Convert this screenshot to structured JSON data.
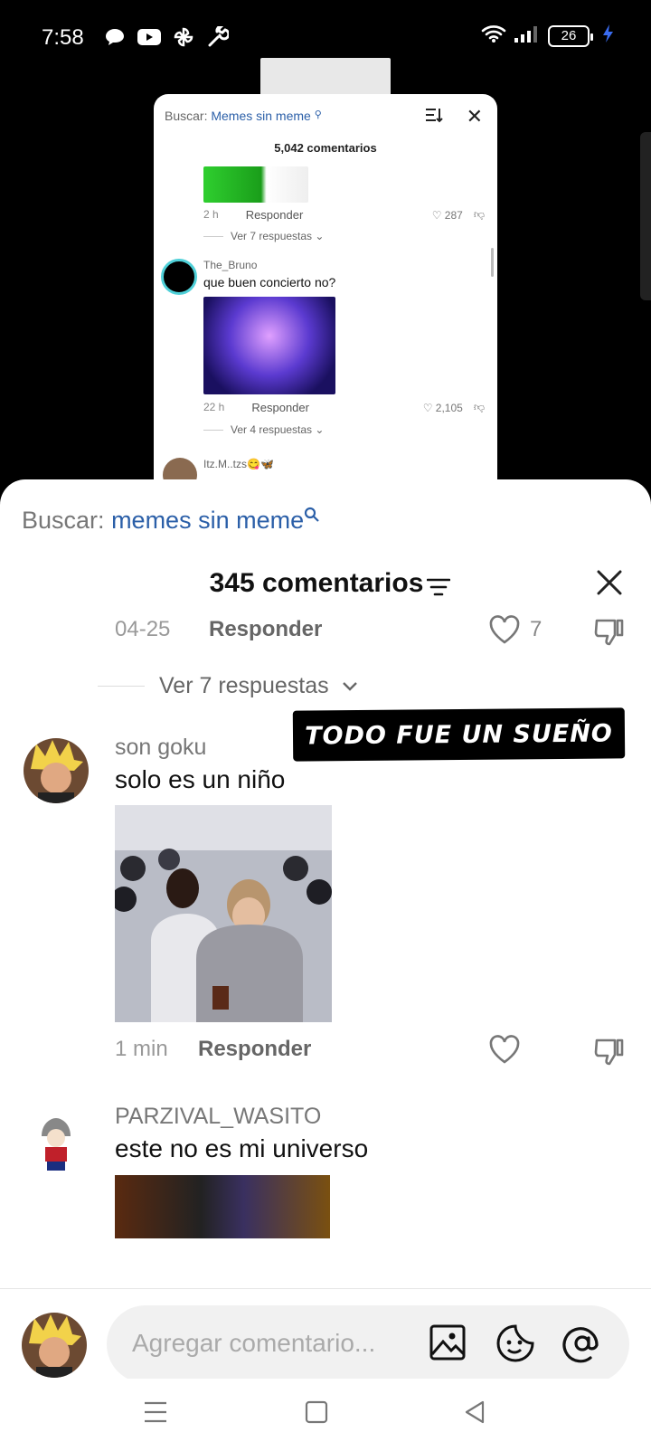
{
  "status_bar": {
    "time": "7:58",
    "battery": "26",
    "icons_left": [
      "chat-bubble-icon",
      "youtube-icon",
      "pinwheel-icon",
      "wrench-icon"
    ],
    "icons_right": [
      "wifi-icon",
      "signal-icon",
      "battery-icon",
      "charging-icon"
    ]
  },
  "mini_panel": {
    "search_label": "Buscar:",
    "search_query": "Memes sin meme",
    "count": "5,042 comentarios",
    "comment1": {
      "time": "2 h",
      "reply": "Responder",
      "likes": "287",
      "replies": "Ver 7 respuestas"
    },
    "comment2": {
      "user": "The_Bruno",
      "text": "que buen concierto no?",
      "time": "22 h",
      "reply": "Responder",
      "likes": "2,105",
      "replies": "Ver 4 respuestas"
    },
    "comment3": {
      "user": "Itz.M..tzs😋🦋"
    }
  },
  "sheet": {
    "search_label": "Buscar:",
    "search_query": "memes sin meme",
    "title": "345 comentarios",
    "comments": [
      {
        "time": "04-25",
        "reply": "Responder",
        "likes": "7",
        "replies": "Ver 7 respuestas"
      },
      {
        "user": "son goku",
        "text": "solo es un niño",
        "time": "1 min",
        "reply": "Responder",
        "overlay": "TODO FUE UN SUEÑO"
      },
      {
        "user": "PARZIVAL_WASITO",
        "text": "este no es mi universo"
      }
    ],
    "composer_placeholder": "Agregar comentario..."
  },
  "colors": {
    "accent_link": "#2b5fa8",
    "ring": "#4fd0d8"
  }
}
